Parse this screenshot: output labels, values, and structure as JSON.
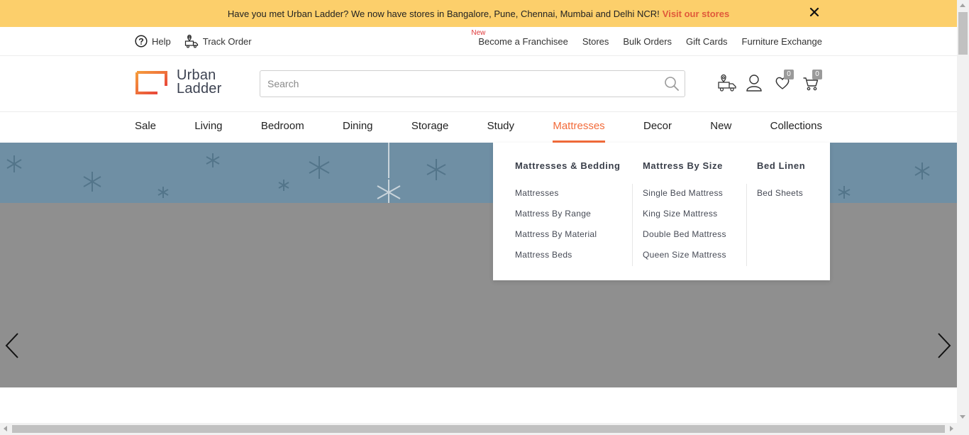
{
  "announcement": {
    "text": "Have you met Urban Ladder? We now have stores in Bangalore, Pune, Chennai, Mumbai and Delhi NCR!",
    "link": "Visit our stores",
    "close_icon": "close-icon"
  },
  "utility": {
    "help": "Help",
    "track_order": "Track Order",
    "new_badge": "New",
    "right_links": [
      "Become a Franchisee",
      "Stores",
      "Bulk Orders",
      "Gift Cards",
      "Furniture Exchange"
    ]
  },
  "header": {
    "logo_line1": "Urban",
    "logo_line2": "Ladder",
    "search_placeholder": "Search",
    "wishlist_count": "0",
    "cart_count": "0"
  },
  "nav": {
    "items": [
      "Sale",
      "Living",
      "Bedroom",
      "Dining",
      "Storage",
      "Study",
      "Mattresses",
      "Decor",
      "New",
      "Collections"
    ],
    "active": "Mattresses"
  },
  "dropdown": {
    "columns": [
      {
        "heading": "Mattresses & Bedding",
        "links": [
          "Mattresses",
          "Mattress By Range",
          "Mattress By Material",
          "Mattress Beds"
        ]
      },
      {
        "heading": "Mattress By Size",
        "links": [
          "Single Bed Mattress",
          "King Size Mattress",
          "Double Bed Mattress",
          "Queen Size Mattress"
        ]
      },
      {
        "heading": "Bed Linen",
        "links": [
          "Bed Sheets"
        ]
      }
    ]
  },
  "colors": {
    "announcement_bg": "#fccf6b",
    "accent": "#f26b3a",
    "link_red": "#e0593a"
  }
}
